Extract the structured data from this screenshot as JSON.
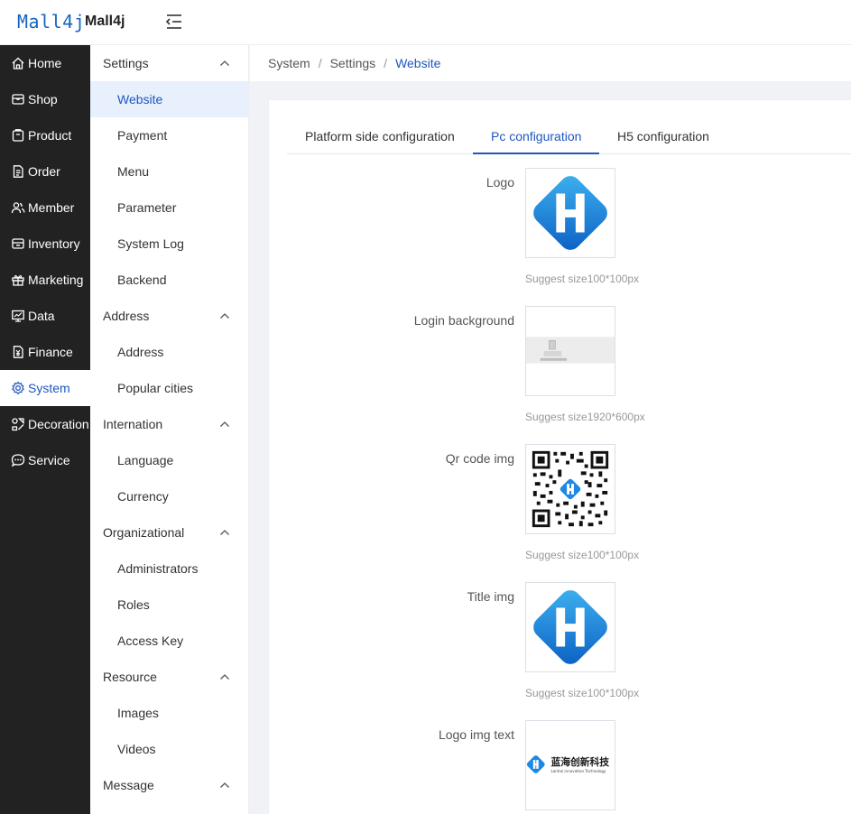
{
  "header": {
    "logo_text": "Mall4j",
    "app_name": "Mall4j"
  },
  "nav": [
    {
      "label": "Home",
      "icon": "home-icon"
    },
    {
      "label": "Shop",
      "icon": "shop-icon"
    },
    {
      "label": "Product",
      "icon": "product-icon"
    },
    {
      "label": "Order",
      "icon": "order-icon"
    },
    {
      "label": "Member",
      "icon": "member-icon"
    },
    {
      "label": "Inventory",
      "icon": "inventory-icon"
    },
    {
      "label": "Marketing",
      "icon": "gift-icon"
    },
    {
      "label": "Data",
      "icon": "chart-icon"
    },
    {
      "label": "Finance",
      "icon": "finance-icon"
    },
    {
      "label": "System",
      "icon": "gear-icon"
    },
    {
      "label": "Decoration",
      "icon": "decoration-icon"
    },
    {
      "label": "Service",
      "icon": "chat-icon"
    }
  ],
  "submenu": {
    "groups": [
      {
        "label": "Settings",
        "items": [
          "Website",
          "Payment",
          "Menu",
          "Parameter",
          "System Log",
          "Backend"
        ]
      },
      {
        "label": "Address",
        "items": [
          "Address",
          "Popular cities"
        ]
      },
      {
        "label": "Internation",
        "items": [
          "Language",
          "Currency"
        ]
      },
      {
        "label": "Organizational",
        "items": [
          "Administrators",
          "Roles",
          "Access Key"
        ]
      },
      {
        "label": "Resource",
        "items": [
          "Images",
          "Videos"
        ]
      },
      {
        "label": "Message",
        "items": []
      }
    ]
  },
  "breadcrumb": {
    "items": [
      "System",
      "Settings"
    ],
    "current": "Website",
    "separator": "/"
  },
  "tabs": [
    {
      "label": "Platform side configuration"
    },
    {
      "label": "Pc configuration"
    },
    {
      "label": "H5 configuration"
    }
  ],
  "fields": [
    {
      "label": "Logo",
      "hint": "Suggest size100*100px"
    },
    {
      "label": "Login background",
      "hint": "Suggest size1920*600px"
    },
    {
      "label": "Qr code img",
      "hint": "Suggest size100*100px"
    },
    {
      "label": "Title img",
      "hint": "Suggest size100*100px"
    },
    {
      "label": "Logo img text",
      "hint": "",
      "logo_cn": "蓝海创新科技",
      "logo_en": "Lanhai innovation Technology"
    }
  ],
  "colors": {
    "accent": "#1f56c0",
    "nav_bg": "#222222"
  }
}
